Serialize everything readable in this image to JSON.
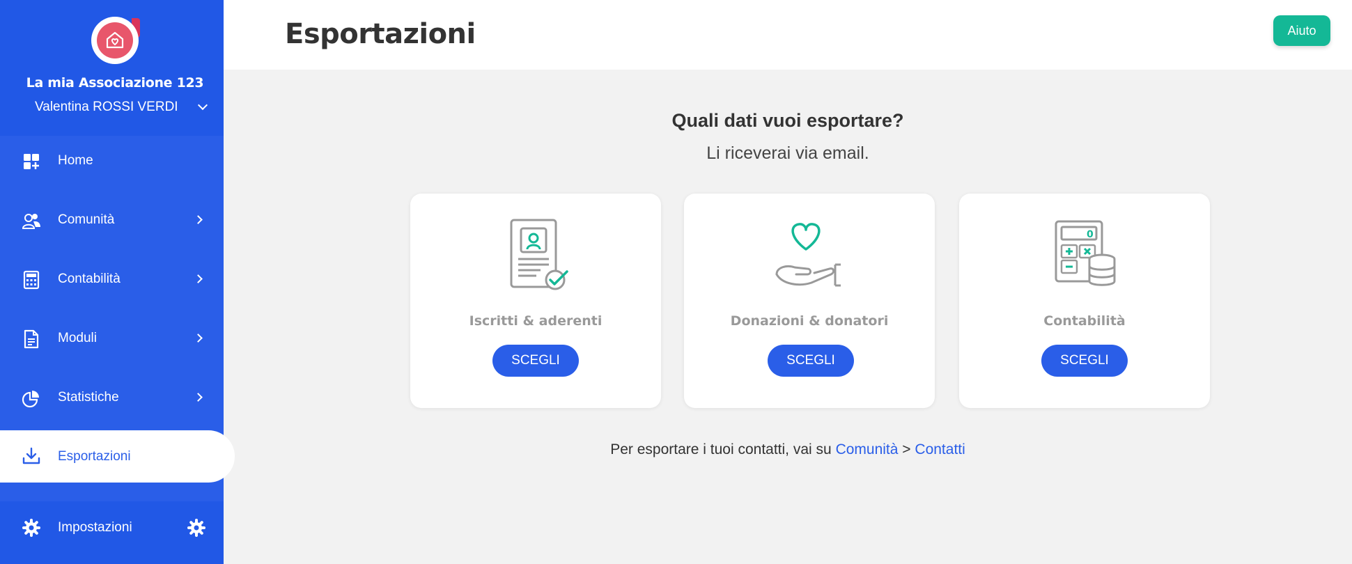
{
  "sidebar": {
    "org_name": "La mia Associazione 123",
    "user_name": "Valentina ROSSI VERDI",
    "items": [
      {
        "label": "Home",
        "icon": "grid-plus-icon"
      },
      {
        "label": "Comunità",
        "icon": "users-icon"
      },
      {
        "label": "Contabilità",
        "icon": "calculator-icon"
      },
      {
        "label": "Moduli",
        "icon": "document-icon"
      },
      {
        "label": "Statistiche",
        "icon": "pie-chart-icon"
      },
      {
        "label": "Esportazioni",
        "icon": "download-icon"
      }
    ],
    "settings_label": "Impostazioni"
  },
  "header": {
    "title": "Esportazioni",
    "help_label": "Aiuto"
  },
  "main": {
    "question": "Quali dati vuoi esportare?",
    "subtext": "Li riceverai via email.",
    "cards": [
      {
        "label": "Iscritti & aderenti",
        "button": "SCEGLI",
        "icon": "member-certificate-icon"
      },
      {
        "label": "Donazioni & donatori",
        "button": "SCEGLI",
        "icon": "heart-hand-icon"
      },
      {
        "label": "Contabilità",
        "button": "SCEGLI",
        "icon": "calculator-coins-icon"
      }
    ],
    "footer": {
      "prefix": "Per esportare i tuoi contatti, vai su",
      "link1": "Comunità",
      "separator": ">",
      "link2": "Contatti"
    }
  },
  "colors": {
    "primary": "#2a5ee8",
    "accent": "#14b896",
    "logo": "#e8566b"
  }
}
